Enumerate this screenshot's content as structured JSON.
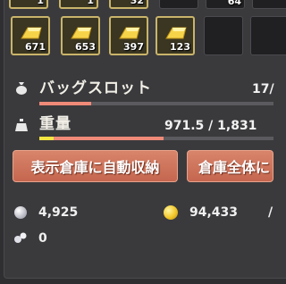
{
  "inventory": {
    "top_row": [
      {
        "qty": "1"
      },
      {
        "qty": "32"
      },
      {
        "qty": "64"
      }
    ],
    "items": [
      {
        "qty": "671"
      },
      {
        "qty": "653"
      },
      {
        "qty": "397"
      },
      {
        "qty": "123"
      }
    ]
  },
  "bag_slots": {
    "label": "バッグスロット",
    "value": "17/",
    "fill_fraction": 0.22
  },
  "weight": {
    "label": "重量",
    "value": "971.5 / 1,831",
    "fill_fraction": 0.53,
    "yellow_fraction": 0.06
  },
  "buttons": {
    "auto_store": "表示倉庫に自動収納",
    "warehouse_all": "倉庫全体に"
  },
  "currency": {
    "silver": "4,925",
    "gold": "94,433",
    "extra_mark": "/",
    "misc": "0"
  },
  "colors": {
    "bar_fill": "#ef8a78",
    "bar_yellow": "#f4e542",
    "button": "#cf7058"
  }
}
